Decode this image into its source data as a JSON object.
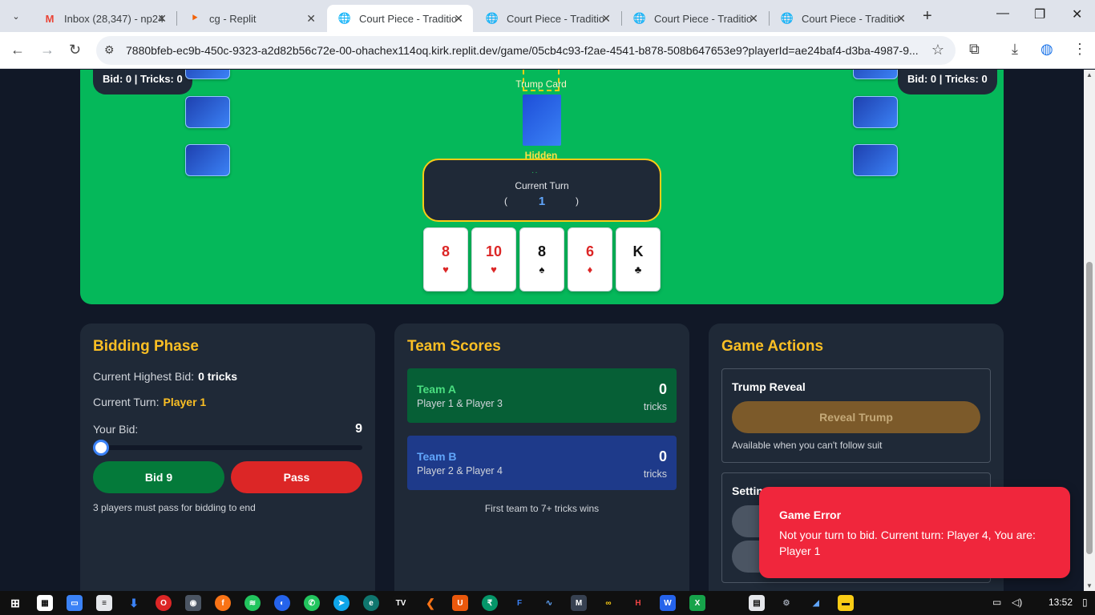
{
  "browser": {
    "tabs": [
      {
        "title": "Inbox (28,347) - np24",
        "favicon": "gmail-icon"
      },
      {
        "title": "cg - Replit",
        "favicon": "replit-icon"
      },
      {
        "title": "Court Piece - Traditio",
        "favicon": "globe-icon"
      },
      {
        "title": "Court Piece - Traditio",
        "favicon": "globe-icon"
      },
      {
        "title": "Court Piece - Traditio",
        "favicon": "globe-icon"
      },
      {
        "title": "Court Piece - Traditio",
        "favicon": "globe-icon"
      }
    ],
    "url": "7880bfeb-ec9b-450c-9323-a2d82b56c72e-00-ohachex114oq.kirk.replit.dev/game/05cb4c93-f2ae-4541-b878-508b647653e9?playerId=ae24baf4-d3ba-4987-9..."
  },
  "table": {
    "left_opponent": {
      "bid_text": "Bid: 0 | Tricks: 0"
    },
    "right_opponent": {
      "bid_text": "Bid: 0 | Tricks: 0"
    },
    "trump_label": "Trump Card",
    "trump_status": "Hidden",
    "current_turn_label": "Current Turn",
    "current_turn_value": "1",
    "hand": [
      {
        "rank": "8",
        "suit": "♥",
        "color": "red"
      },
      {
        "rank": "10",
        "suit": "♥",
        "color": "red"
      },
      {
        "rank": "8",
        "suit": "♠",
        "color": "black"
      },
      {
        "rank": "6",
        "suit": "♦",
        "color": "red"
      },
      {
        "rank": "K",
        "suit": "♣",
        "color": "black"
      }
    ]
  },
  "bidding": {
    "title": "Bidding Phase",
    "highest_label": "Current Highest Bid:",
    "highest_value": "0 tricks",
    "turn_label": "Current Turn:",
    "turn_value": "Player 1",
    "your_bid_label": "Your Bid:",
    "your_bid_value": "9",
    "bid_button": "Bid 9",
    "pass_button": "Pass",
    "note": "3 players must pass for bidding to end"
  },
  "scores": {
    "title": "Team Scores",
    "teams": [
      {
        "name": "Team A",
        "players": "Player 1 & Player 3",
        "score": "0",
        "unit": "tricks"
      },
      {
        "name": "Team B",
        "players": "Player 2 & Player 4",
        "score": "0",
        "unit": "tricks"
      }
    ],
    "note": "First team to 7+ tricks wins"
  },
  "actions": {
    "title": "Game Actions",
    "trump_reveal_title": "Trump Reveal",
    "reveal_button": "Reveal Trump",
    "reveal_note": "Available when you can't follow suit",
    "settings_title": "Settin"
  },
  "toast": {
    "title": "Game Error",
    "message": "Not your turn to bid. Current turn: Player 4, You are: Player 1"
  },
  "taskbar": {
    "time": "13:52"
  },
  "colors": {
    "table_green": "#05b85a",
    "accent_yellow": "#fbbf24",
    "panel_bg": "#1f2937",
    "error_red": "#f0263c"
  }
}
